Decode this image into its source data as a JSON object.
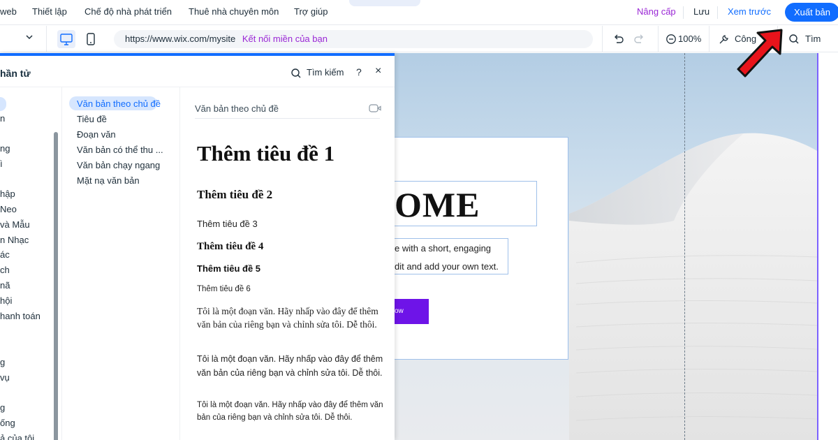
{
  "topbar": {
    "menu": [
      "web",
      "Thiết lập",
      "Chế độ nhà phát triển",
      "Thuê nhà chuyên môn",
      "Trợ giúp"
    ],
    "upgrade_label": "Nâng cấp",
    "save_label": "Lưu",
    "preview_label": "Xem trước",
    "publish_label": "Xuất bản",
    "indicator_glyph": "^"
  },
  "toolbar": {
    "url": "https://www.wix.com/mysite",
    "connect_domain": "Kết nối miền của bạn",
    "zoom": "100%",
    "tools_label": "Công",
    "search_label": "Tìm kiếm"
  },
  "panel": {
    "title": "hần tử",
    "search_label": "Tìm kiếm",
    "help_glyph": "?",
    "close_glyph": "×",
    "categories": [
      "n",
      "ng",
      "ì",
      "hập",
      "Neo",
      "và Mẫu",
      "n Nhạc",
      "ác",
      "ch",
      "nã",
      "hội",
      "hanh toán",
      "g",
      "vụ",
      "g",
      "ống",
      "ả của tôi"
    ],
    "subcategories": [
      "Văn bản theo chủ đề",
      "Tiêu đề",
      "Đoạn văn",
      "Văn bản có thể thu ...",
      "Văn bản chạy ngang",
      "Mặt nạ văn bản"
    ],
    "content": {
      "header": "Văn bản theo chủ đề",
      "h1": "Thêm tiêu đề 1",
      "h2": "Thêm tiêu đề 2",
      "h3": "Thêm tiêu đề 3",
      "h4": "Thêm tiêu đề 4",
      "h5": "Thêm tiêu đề 5",
      "h6": "Thêm tiêu đề 6",
      "p1": "Tôi là một đoạn văn. Hãy nhấp vào đây để thêm văn bản của riêng bạn và chỉnh sửa tôi. Dễ thôi.",
      "p2": "Tôi là một đoạn văn. Hãy nhấp vào đây để thêm văn bản của riêng bạn và chỉnh sửa tôi. Dễ thôi.",
      "p3": "Tôi là một đoạn văn. Hãy nhấp vào đây để thêm văn bản của riêng bạn và chỉnh sửa tôi. Dễ thôi."
    }
  },
  "canvas": {
    "welcome": "OME",
    "para_line1": "e with a short, engaging",
    "para_line2": "dit and add your own text.",
    "cta_label": "ow"
  },
  "colors": {
    "accent": "#116dff",
    "upgrade": "#9a27d5",
    "cta": "#6e14e8",
    "arrow": "#e8131b"
  }
}
